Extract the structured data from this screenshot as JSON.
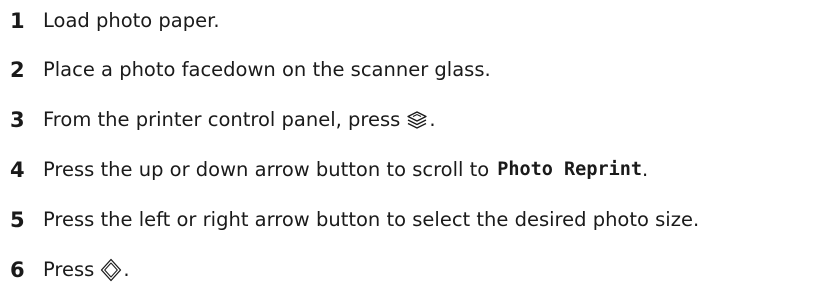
{
  "steps": [
    {
      "number": "1",
      "text": "Load photo paper."
    },
    {
      "number": "2",
      "text": "Place a photo facedown on the scanner glass."
    },
    {
      "number": "3",
      "text": "From the printer control panel, press",
      "icon": "layers-copy-icon",
      "suffix": "."
    },
    {
      "number": "4",
      "text": "Press the up or down arrow button to scroll to",
      "code": "Photo Reprint",
      "suffix": "."
    },
    {
      "number": "5",
      "text": "Press the left or right arrow button to select the desired photo size."
    },
    {
      "number": "6",
      "text": "Press",
      "icon": "start-diamond-icon",
      "suffix": "."
    }
  ]
}
